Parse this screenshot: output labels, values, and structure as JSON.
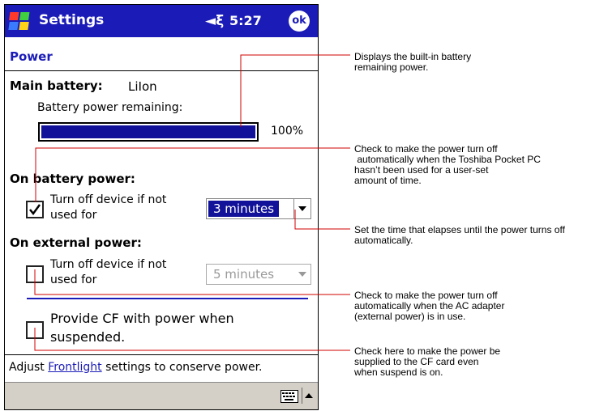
{
  "titlebar": {
    "app_title": "Settings",
    "volume_icon": "speaker-mute-icon",
    "clock": "5:27",
    "ok_label": "ok",
    "start_icon": "windows-flag-icon"
  },
  "page": {
    "heading": "Power"
  },
  "main_battery": {
    "label": "Main battery:",
    "type": "LiIon",
    "remaining_label": "Battery power remaining:",
    "percent_text": "100%",
    "level": 1.0,
    "bar_color": "#111199"
  },
  "battery_power": {
    "heading": "On battery power:",
    "checkbox_checked": true,
    "line1": "Turn off device if not",
    "line2": "used for",
    "dropdown_value": "3 minutes"
  },
  "external_power": {
    "heading": "On external power:",
    "checkbox_checked": false,
    "line1": "Turn off device if not",
    "line2": "used for",
    "dropdown_value": "5 minutes"
  },
  "cf_power": {
    "checkbox_checked": false,
    "line1": "Provide CF with power when",
    "line2": "suspended."
  },
  "footer": {
    "prefix": "Adjust ",
    "link": "Frontlight",
    "suffix": " settings to conserve power."
  },
  "taskbar": {
    "keyboard_icon": "keyboard-icon",
    "sip_icon": "up-arrow-icon"
  },
  "annotations": {
    "battery": [
      "Displays the built-in battery",
      "remaining power."
    ],
    "auto_off": [
      "Check to make the power turn off",
      " automatically when the Toshiba Pocket PC",
      "hasn’t been used for a user-set",
      "amount of time."
    ],
    "time_set": [
      "Set the time that elapses until the power turns off",
      "automatically."
    ],
    "ac_adapter": [
      "Check to make the power turn off",
      "automatically when the AC adapter",
      "(external power) is in use."
    ],
    "cf_card": [
      "Check here to make the power be",
      "supplied to the CF card even",
      "when suspend is on."
    ]
  },
  "colors": {
    "accent": "#1b1bb8",
    "leader": "#d00000",
    "taskbar": "#d4d0c8"
  }
}
